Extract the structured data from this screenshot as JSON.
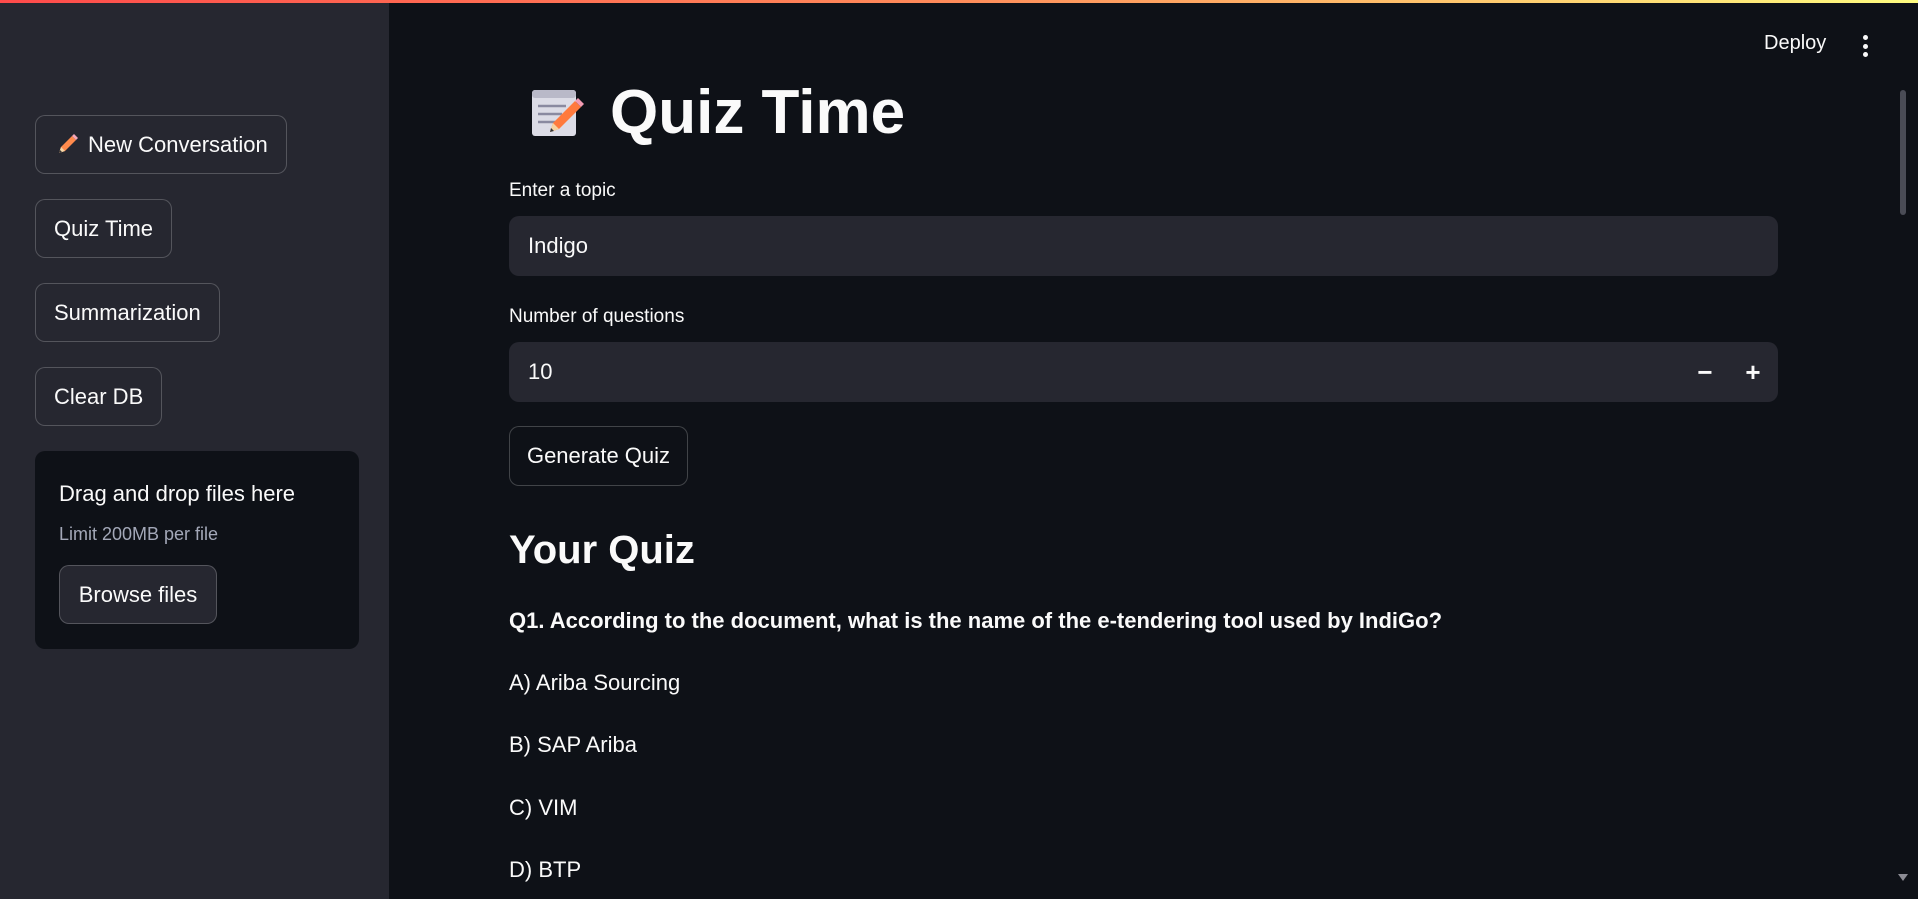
{
  "sidebar": {
    "buttons": [
      {
        "label": "New Conversation",
        "icon": "pencil-icon"
      },
      {
        "label": "Quiz Time"
      },
      {
        "label": "Summarization"
      },
      {
        "label": "Clear DB"
      }
    ],
    "uploader": {
      "title": "Drag and drop files here",
      "limit": "Limit 200MB per file",
      "browse_label": "Browse files"
    }
  },
  "header": {
    "deploy_label": "Deploy",
    "menu_icon": "vertical-ellipsis-icon"
  },
  "main": {
    "title": "Quiz Time",
    "title_icon": "memo-icon",
    "topic": {
      "label": "Enter a topic",
      "value": "Indigo"
    },
    "num_questions": {
      "label": "Number of questions",
      "value": "10",
      "minus": "−",
      "plus": "+"
    },
    "generate_label": "Generate Quiz",
    "quiz_heading": "Your Quiz",
    "question": "Q1. According to the document, what is the name of the e-tendering tool used by IndiGo?",
    "options": [
      "A) Ariba Sourcing",
      "B) SAP Ariba",
      "C) VIM",
      "D) BTP"
    ]
  },
  "colors": {
    "background": "#0e1117",
    "sidebar": "#262730",
    "input": "#262730",
    "text": "#fafafa",
    "accent_gradient_start": "#ff4b4b",
    "accent_gradient_end": "#fffd80"
  }
}
